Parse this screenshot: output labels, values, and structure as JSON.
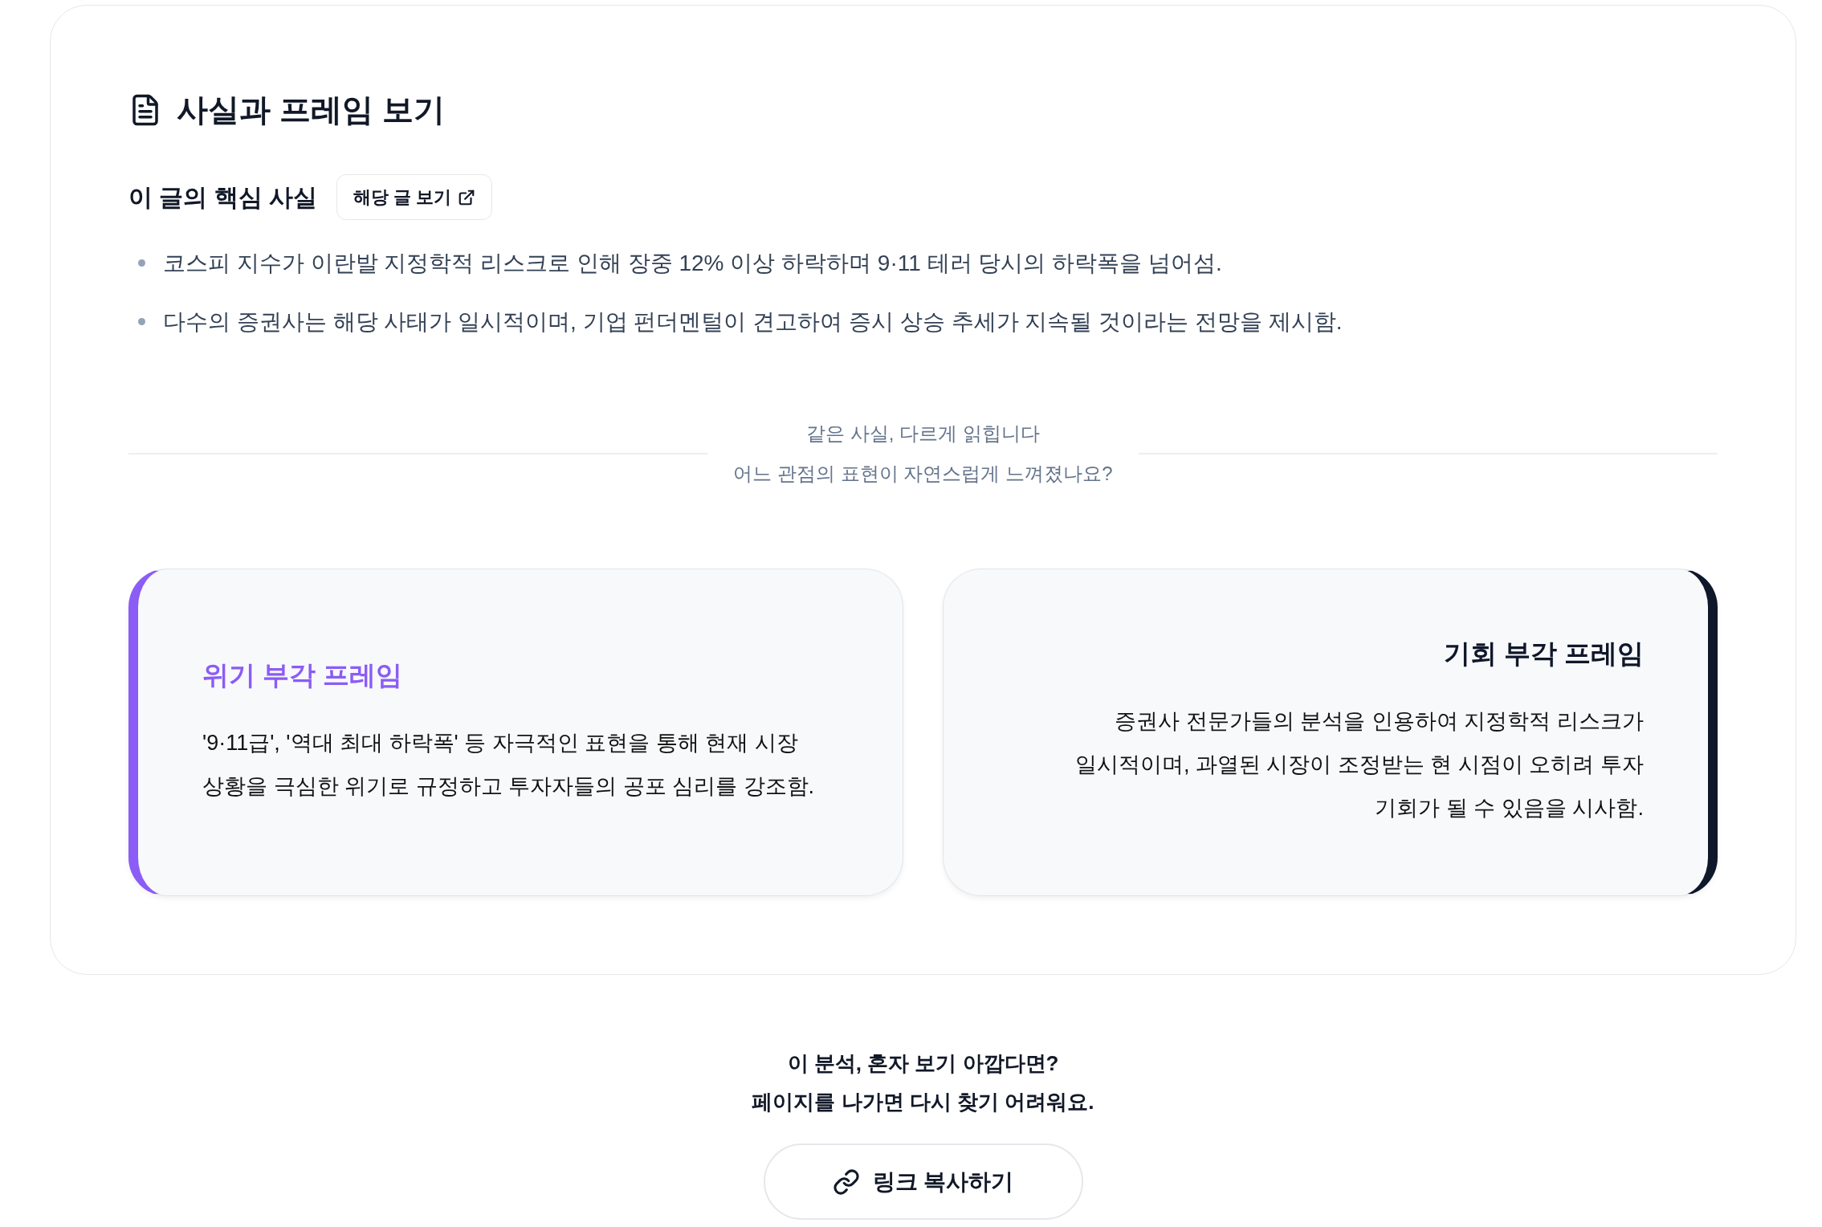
{
  "section": {
    "title": "사실과 프레임 보기"
  },
  "key_facts": {
    "heading": "이 글의 핵심 사실",
    "source_button": "해당 글 보기",
    "items": [
      "코스피 지수가 이란발 지정학적 리스크로 인해 장중 12% 이상 하락하며 9·11 테러 당시의 하락폭을 넘어섬.",
      "다수의 증권사는 해당 사태가 일시적이며, 기업 펀더멘털이 견고하여 증시 상승 추세가 지속될 것이라는 전망을 제시함."
    ]
  },
  "divider": {
    "lines": [
      "같은 사실, 다르게 읽힙니다",
      "어느 관점의 표현이 자연스럽게 느껴졌나요?"
    ]
  },
  "frames": [
    {
      "kind": "leftaccent",
      "color": "#8b5cf6",
      "title": "위기 부각 프레임",
      "text": "'9·11급', '역대 최대 하락폭' 등 자극적인 표현을 통해 현재 시장 상황을 극심한 위기로 규정하고 투자자들의 공포 심리를 강조함."
    },
    {
      "kind": "rightaccent",
      "color": "#0f172a",
      "title": "기회 부각 프레임",
      "text": "증권사 전문가들의 분석을 인용하여 지정학적 리스크가 일시적이며, 과열된 시장이 조정받는 현 시점이 오히려 투자 기회가 될 수 있음을 시사함."
    }
  ],
  "share": {
    "lines": [
      "이 분석, 혼자 보기 아깝다면?",
      "페이지를 나가면 다시 찾기 어려워요."
    ],
    "button": "링크 복사하기"
  }
}
